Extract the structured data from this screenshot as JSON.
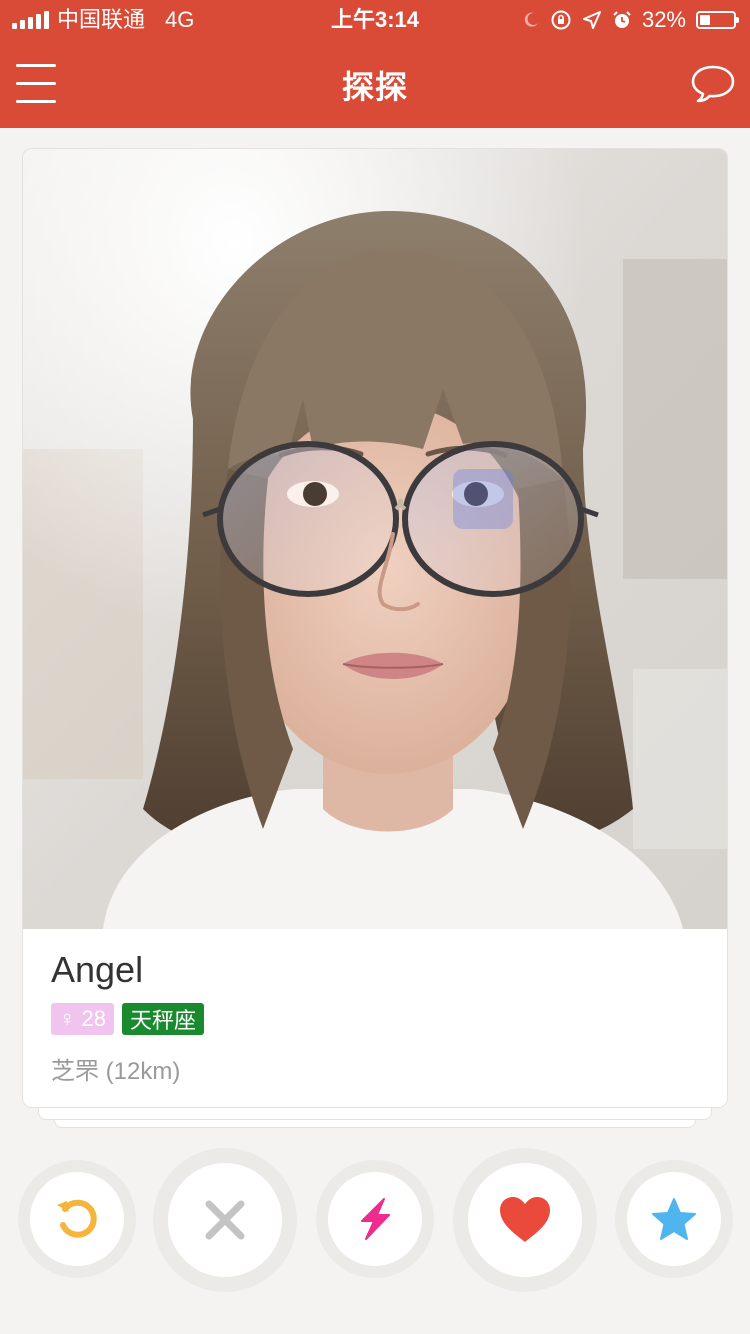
{
  "status_bar": {
    "carrier": "中国联通",
    "network": "4G",
    "time": "上午3:14",
    "battery": "32%"
  },
  "nav": {
    "title": "探探"
  },
  "profile": {
    "name": "Angel",
    "gender_symbol": "♀",
    "age": "28",
    "zodiac": "天秤座",
    "location": "芝罘 (12km)"
  },
  "colors": {
    "header": "#d94b37",
    "zodiac_tag": "#1a8a2e",
    "gender_tag": "#f1c3ef",
    "undo": "#f5b43c",
    "nope": "#c4c4c4",
    "boost": "#ee2b8f",
    "like": "#ea4a3b",
    "super_like": "#4fb5ef"
  },
  "actions": [
    {
      "name": "undo-button",
      "icon": "undo-icon"
    },
    {
      "name": "dislike-button",
      "icon": "close-icon"
    },
    {
      "name": "boost-button",
      "icon": "lightning-icon"
    },
    {
      "name": "like-button",
      "icon": "heart-icon"
    },
    {
      "name": "super-like-button",
      "icon": "star-icon"
    }
  ]
}
